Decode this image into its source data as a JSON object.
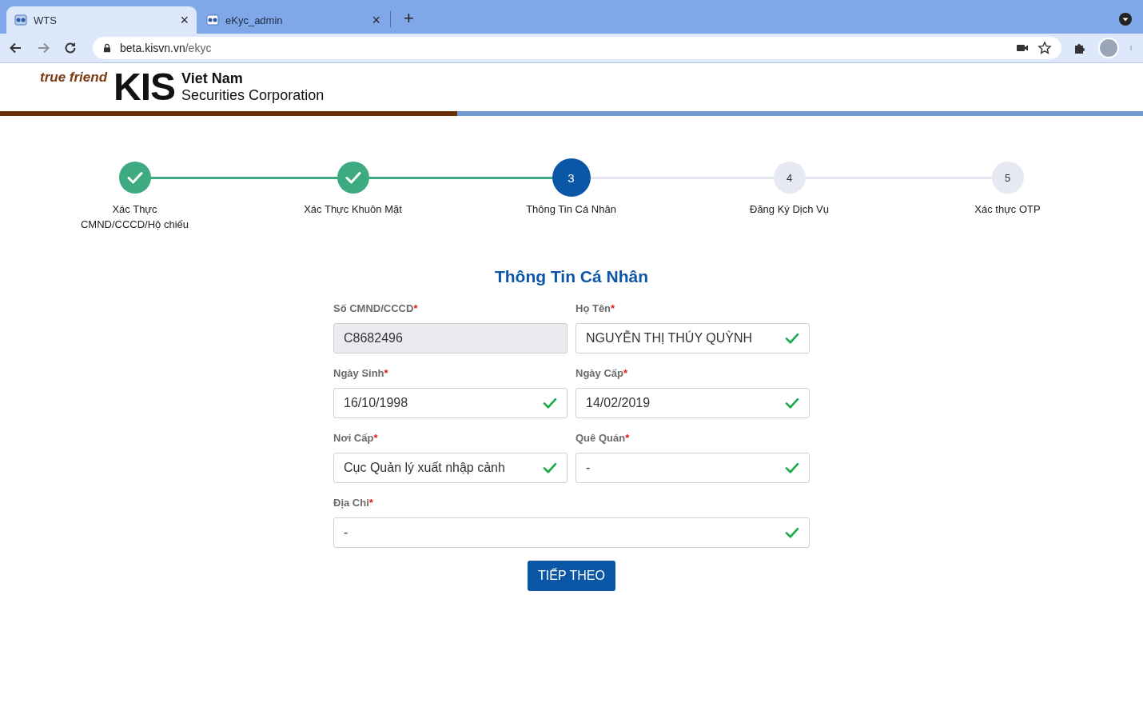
{
  "browser": {
    "tabs": [
      {
        "title": "WTS",
        "selected": true,
        "close": "×"
      },
      {
        "title": "eKyc_admin",
        "selected": false,
        "close": "×"
      }
    ],
    "new_tab": "+",
    "url_host": "beta.kisvn.vn",
    "url_path": "/ekyc"
  },
  "logo": {
    "tagline": "true friend",
    "brand": "KIS",
    "line_1": "Viet Nam",
    "line_2": "Securities Corporation"
  },
  "steps": [
    {
      "label": "Xác Thực CMND/CCCD/Hộ chiếu",
      "kind": "done"
    },
    {
      "label": "Xác Thực Khuôn Mặt",
      "kind": "done"
    },
    {
      "label": "Thông Tin Cá Nhân",
      "kind": "current",
      "number": "3"
    },
    {
      "label": "Đăng Ký Dịch Vụ",
      "kind": "todo",
      "number": "4"
    },
    {
      "label": "Xác thực OTP",
      "kind": "todo",
      "number": "5"
    }
  ],
  "form": {
    "title": "Thông Tin Cá Nhân",
    "fields": [
      {
        "label": "Số CMND/CCCD",
        "asterisk": "*",
        "value": "C8682496",
        "disabled": true,
        "valid": false,
        "wide": false
      },
      {
        "label": "Họ Tên",
        "asterisk": "*",
        "value": "NGUYỄN THỊ THÚY QUỲNH",
        "disabled": false,
        "valid": true,
        "wide": false
      },
      {
        "label": "Ngày Sinh",
        "asterisk": "*",
        "value": "16/10/1998",
        "disabled": false,
        "valid": true,
        "wide": false
      },
      {
        "label": "Ngày Cấp",
        "asterisk": "*",
        "value": "14/02/2019",
        "disabled": false,
        "valid": true,
        "wide": false
      },
      {
        "label": "Nơi Cấp",
        "asterisk": "*",
        "value": "Cục Quản lý xuất nhập cảnh",
        "disabled": false,
        "valid": true,
        "wide": false
      },
      {
        "label": "Quê Quán",
        "asterisk": "*",
        "value": "-",
        "disabled": false,
        "valid": true,
        "wide": false
      },
      {
        "label": "Địa Chỉ",
        "asterisk": "*",
        "value": "-",
        "disabled": false,
        "valid": true,
        "wide": true
      }
    ],
    "submit": "TIẾP THEO"
  }
}
